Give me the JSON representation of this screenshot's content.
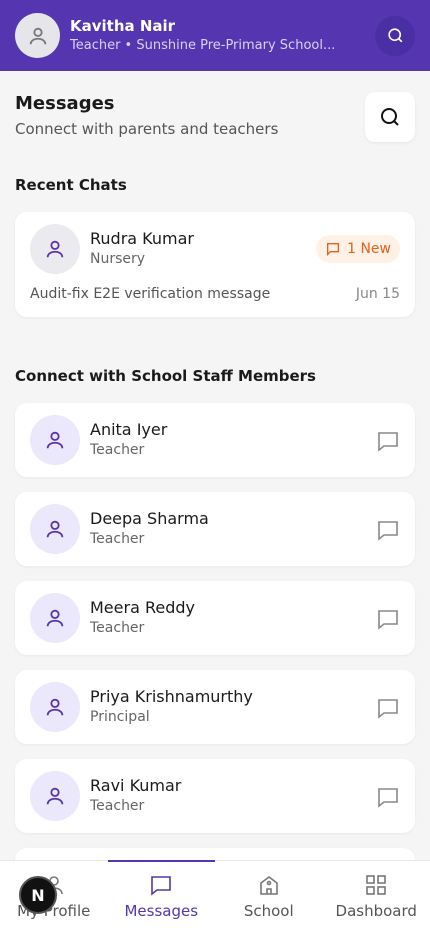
{
  "header": {
    "user_name": "Kavitha Nair",
    "user_role": "Teacher • Sunshine Pre-Primary School..."
  },
  "messages": {
    "title": "Messages",
    "subtitle": "Connect with parents and teachers"
  },
  "recent": {
    "section_title": "Recent Chats",
    "chat": {
      "name": "Rudra Kumar",
      "class": "Nursery",
      "badge": "1 New",
      "preview": "Audit-fix E2E verification message",
      "date": "Jun 15"
    }
  },
  "staff": {
    "section_title": "Connect with School Staff Members",
    "members": [
      {
        "name": "Anita Iyer",
        "role": "Teacher"
      },
      {
        "name": "Deepa Sharma",
        "role": "Teacher"
      },
      {
        "name": "Meera Reddy",
        "role": "Teacher"
      },
      {
        "name": "Priya Krishnamurthy",
        "role": "Principal"
      },
      {
        "name": "Ravi Kumar",
        "role": "Teacher"
      }
    ]
  },
  "nav": {
    "items": [
      {
        "label": "My Profile",
        "icon": "person-icon"
      },
      {
        "label": "Messages",
        "icon": "chat-icon"
      },
      {
        "label": "School",
        "icon": "school-icon"
      },
      {
        "label": "Dashboard",
        "icon": "grid-icon"
      }
    ],
    "active": "Messages"
  },
  "dev_badge": "N",
  "colors": {
    "brand": "#5536b0",
    "badge_text": "#e2621c",
    "badge_bg": "#fff1e6"
  }
}
